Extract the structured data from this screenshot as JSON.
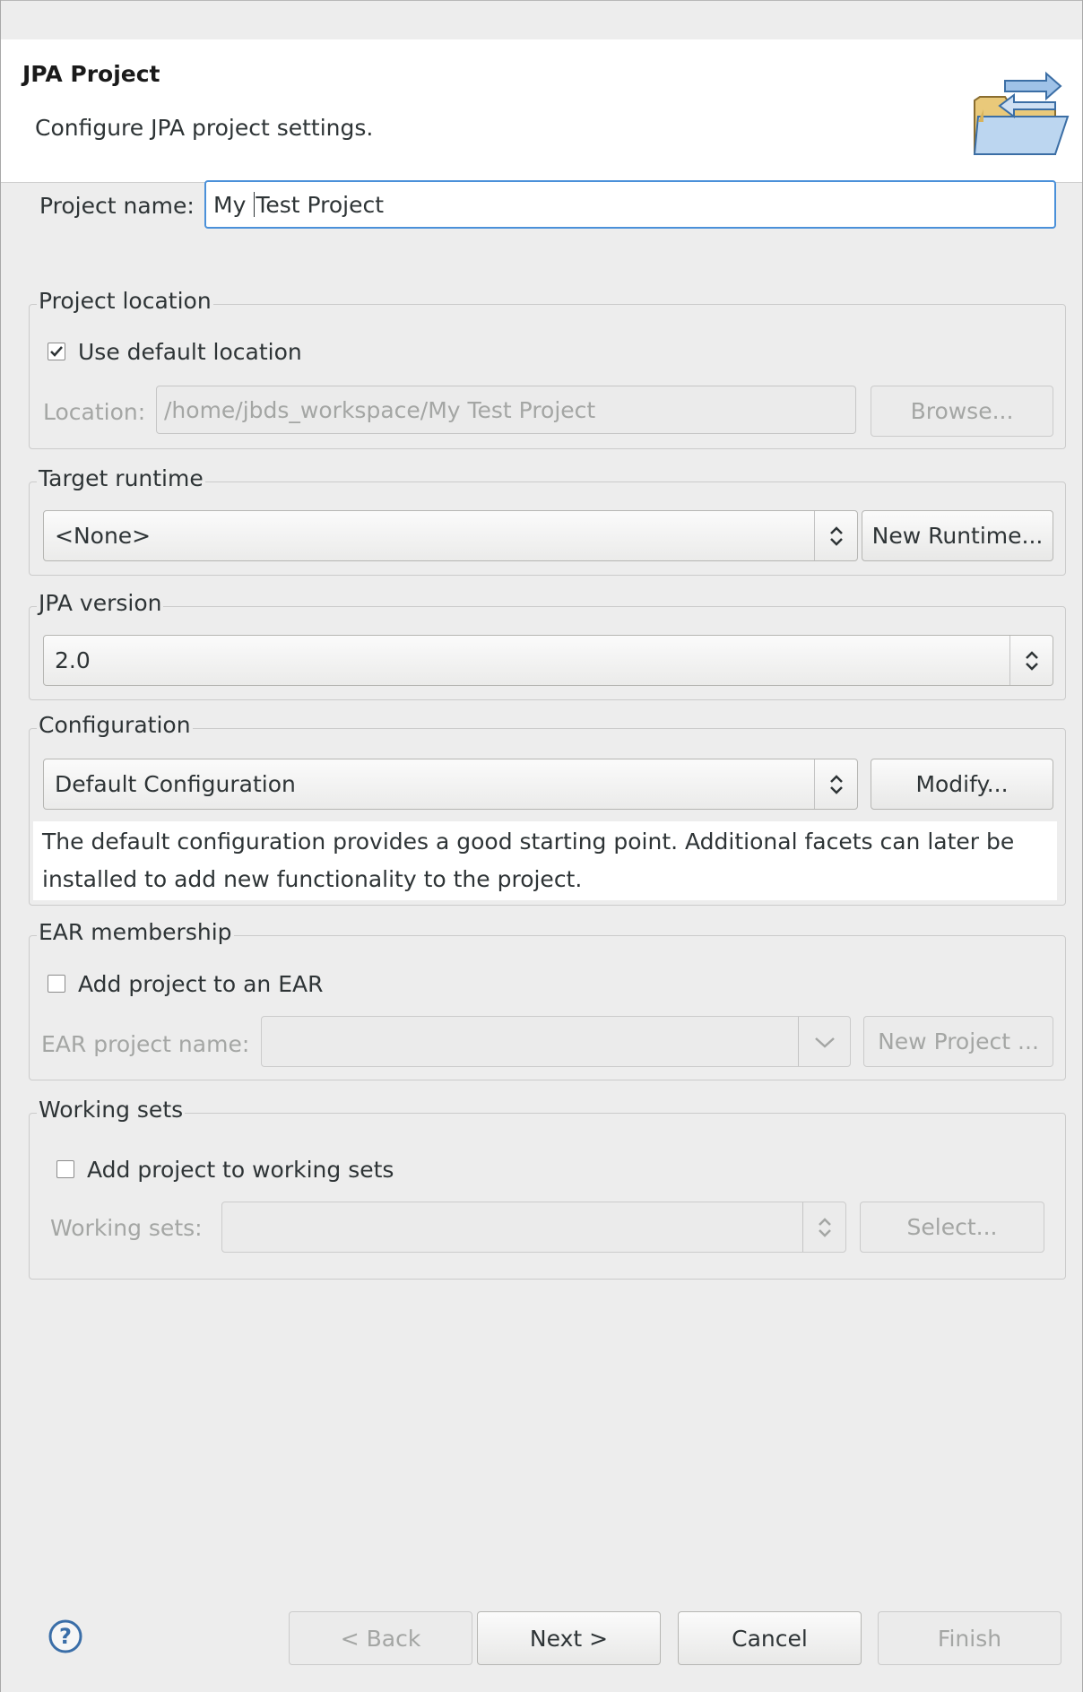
{
  "header": {
    "title": "JPA Project",
    "description": "Configure JPA project settings.",
    "icon": "folder-arrows-icon"
  },
  "project_name": {
    "label": "Project name:",
    "value_before_caret": "My ",
    "value_after_caret": "Test Project"
  },
  "project_location": {
    "legend": "Project location",
    "use_default_label": "Use default location",
    "use_default_checked": true,
    "location_label": "Location:",
    "location_value": "/home/jbds_workspace/My Test Project",
    "browse_label": "Browse..."
  },
  "target_runtime": {
    "legend": "Target runtime",
    "selected": "<None>",
    "new_runtime_label": "New Runtime..."
  },
  "jpa_version": {
    "legend": "JPA version",
    "selected": "2.0"
  },
  "configuration": {
    "legend": "Configuration",
    "selected": "Default Configuration",
    "modify_label": "Modify...",
    "description": "The default configuration provides a good starting point. Additional facets can later be installed to add new functionality to the project."
  },
  "ear_membership": {
    "legend": "EAR membership",
    "add_label": "Add project to an EAR",
    "add_checked": false,
    "name_label": "EAR project name:",
    "new_project_label": "New Project ..."
  },
  "working_sets": {
    "legend": "Working sets",
    "add_label": "Add project to working sets",
    "add_checked": false,
    "sets_label": "Working sets:",
    "select_label": "Select..."
  },
  "footer": {
    "back_label": "< Back",
    "next_label": "Next >",
    "cancel_label": "Cancel",
    "finish_label": "Finish",
    "help_icon": "help-icon"
  },
  "colors": {
    "focus_border": "#4a90d9",
    "disabled_text": "#a4a6a4",
    "background": "#ededed"
  }
}
